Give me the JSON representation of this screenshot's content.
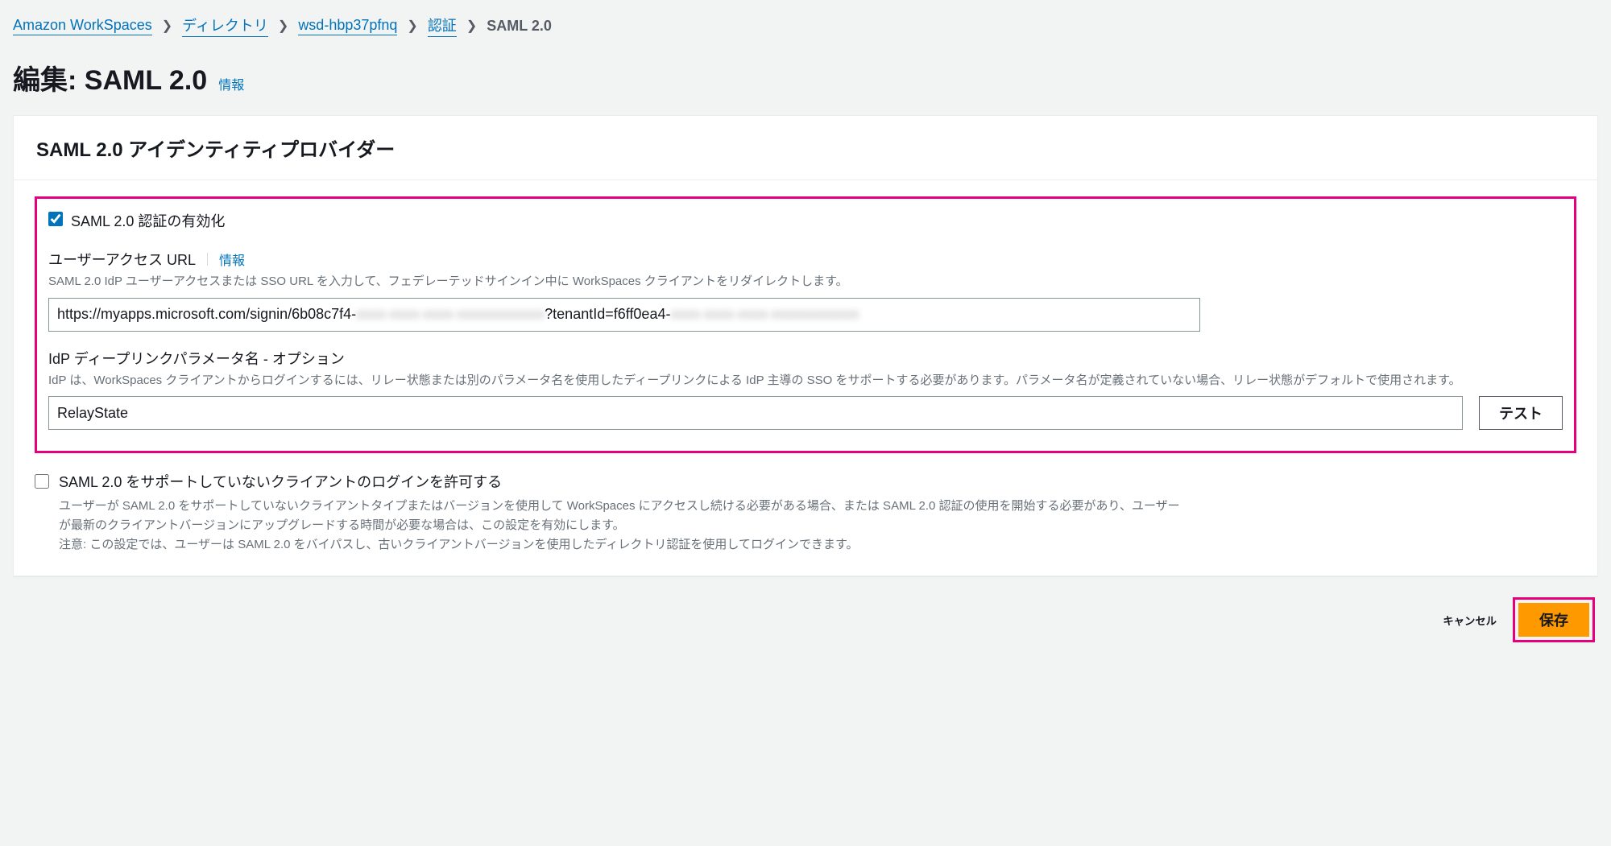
{
  "breadcrumbs": {
    "items": [
      {
        "label": "Amazon WorkSpaces"
      },
      {
        "label": "ディレクトリ"
      },
      {
        "label": "wsd-hbp37pfnq"
      },
      {
        "label": "認証"
      }
    ],
    "current": "SAML 2.0"
  },
  "page": {
    "title": "編集: SAML 2.0",
    "info_label": "情報"
  },
  "panel": {
    "header": "SAML 2.0 アイデンティティプロバイダー",
    "enable_saml": {
      "checked": true,
      "label": "SAML 2.0 認証の有効化"
    },
    "user_access_url": {
      "label": "ユーザーアクセス URL",
      "info_label": "情報",
      "desc": "SAML 2.0 IdP ユーザーアクセスまたは SSO URL を入力して、フェデレーテッドサインイン中に WorkSpaces クライアントをリダイレクトします。",
      "value_visible_prefix": "https://myapps.microsoft.com/signin/6b08c7f4-",
      "value_blurred_mid": "xxxx-xxxx-xxxx-xxxxxxxxxxxx",
      "value_visible_mid": "?tenantId=f6ff0ea4-",
      "value_blurred_suffix": "xxxx-xxxx-xxxx-xxxxxxxxxxxx"
    },
    "deep_link_param": {
      "label": "IdP ディープリンクパラメータ名 - オプション",
      "desc": "IdP は、WorkSpaces クライアントからログインするには、リレー状態または別のパラメータ名を使用したディープリンクによる IdP 主導の SSO をサポートする必要があります。パラメータ名が定義されていない場合、リレー状態がデフォルトで使用されます。",
      "value": "RelayState",
      "test_button": "テスト"
    },
    "allow_fallback": {
      "checked": false,
      "title": "SAML 2.0 をサポートしていないクライアントのログインを許可する",
      "desc": "ユーザーが SAML 2.0 をサポートしていないクライアントタイプまたはバージョンを使用して WorkSpaces にアクセスし続ける必要がある場合、または SAML 2.0 認証の使用を開始する必要があり、ユーザーが最新のクライアントバージョンにアップグレードする時間が必要な場合は、この設定を有効にします。\n注意: この設定では、ユーザーは SAML 2.0 をバイパスし、古いクライアントバージョンを使用したディレクトリ認証を使用してログインできます。"
    }
  },
  "footer": {
    "cancel": "キャンセル",
    "save": "保存"
  }
}
